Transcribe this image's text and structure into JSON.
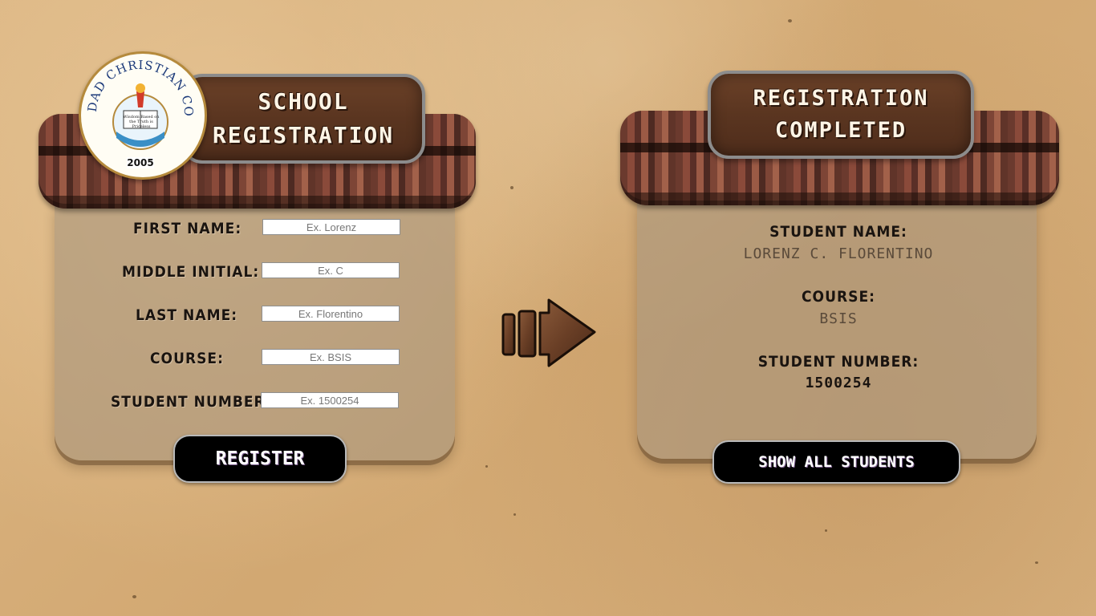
{
  "seal": {
    "arc_text": "LA VERDAD CHRISTIAN COLLEGE",
    "motto": "Wisdom Based on the Truth is Priceless",
    "year": "2005"
  },
  "registration_panel": {
    "title_line1": "SCHOOL",
    "title_line2": "REGISTRATION",
    "fields": [
      {
        "label": "FIRST NAME:",
        "placeholder": "Ex. Lorenz"
      },
      {
        "label": "MIDDLE INITIAL:",
        "placeholder": "Ex. C"
      },
      {
        "label": "LAST NAME:",
        "placeholder": "Ex. Florentino"
      },
      {
        "label": "COURSE:",
        "placeholder": "Ex. BSIS"
      },
      {
        "label": "STUDENT NUMBER:",
        "placeholder": "Ex. 1500254"
      }
    ],
    "register_label": "REGISTER"
  },
  "result_panel": {
    "title_line1": "REGISTRATION",
    "title_line2": "COMPLETED",
    "student_name_label": "STUDENT NAME:",
    "student_name_value": "LORENZ C. FLORENTINO",
    "course_label": "COURSE:",
    "course_value": "BSIS",
    "student_number_label": "STUDENT NUMBER:",
    "student_number_value": "1500254",
    "show_all_label": "SHOW ALL STUDENTS"
  },
  "colors": {
    "background": "#d8b07a",
    "wood_sign": "#5a3520",
    "roof_shingle": "#6b3a2e",
    "button": "#000000"
  },
  "icons": {
    "arrow": "right-arrow-icon",
    "seal": "college-seal-logo"
  }
}
